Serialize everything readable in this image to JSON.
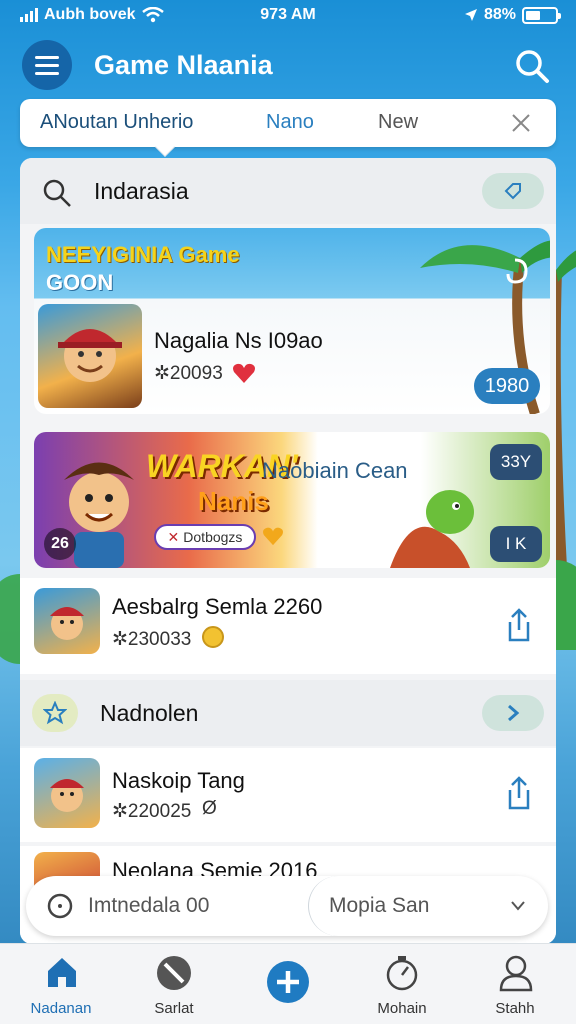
{
  "status": {
    "carrier": "Aubh bovek",
    "time": "973 AM",
    "battery": "88%"
  },
  "header": {
    "title": "Game Nlaania"
  },
  "tabs": [
    {
      "label": "ANoutan Unherio"
    },
    {
      "label": "Nano"
    },
    {
      "label": "New"
    }
  ],
  "section1": {
    "label": "Indarasia"
  },
  "banner": {
    "promo_line1": "NEEYIGINIA Game",
    "promo_line2": "GOON",
    "title": "Nagalia Ns I09ao",
    "subtitle": "✲20093",
    "badge": "1980"
  },
  "banner2": {
    "logo_line1": "WARKAN'",
    "logo_line2": "Nanis",
    "button_label": "Dotbogzs",
    "title": "Naobiain Cean",
    "badge_top": "33Y",
    "badge_bottom": "I K",
    "corner": "26"
  },
  "item1": {
    "title": "Aesbalrg Semla 2260",
    "subtitle": "✲230033"
  },
  "section2": {
    "label": "Nadnolen"
  },
  "item2": {
    "title": "Naskoip Tang",
    "subtitle": "✲220025"
  },
  "item3": {
    "title": "Neolana Semie 2016"
  },
  "search": {
    "placeholder": "Imtnedala 00",
    "segment": "Mopia San"
  },
  "nav": [
    {
      "label": "Nadanan",
      "icon": "home-icon"
    },
    {
      "label": "Sarlat",
      "icon": "slash-circle-icon"
    },
    {
      "label": "",
      "icon": "plus-icon"
    },
    {
      "label": "Mohain",
      "icon": "stopwatch-icon"
    },
    {
      "label": "Stahh",
      "icon": "user-icon"
    }
  ],
  "colors": {
    "accent": "#1f7bc2",
    "header_dark": "#1565a8",
    "heart": "#e0303e"
  }
}
